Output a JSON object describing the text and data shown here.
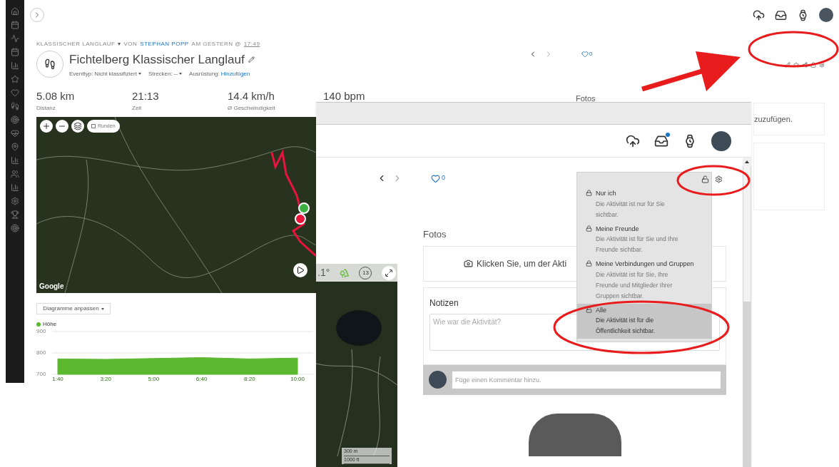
{
  "back_page": {
    "header": {
      "activity_type": "KLASSISCHER LANGLAUF",
      "by": "VON",
      "author": "STEPHAN POPP",
      "when": "AM GESTERN @",
      "time": "17:49",
      "title": "Fichtelberg Klassischer Langlauf"
    },
    "meta": [
      {
        "label": "Eventtyp:",
        "value": "Nicht klassifiziert",
        "kind": "dropdown"
      },
      {
        "label": "Strecken:",
        "value": "--",
        "kind": "dropdown"
      },
      {
        "label": "Ausrüstung:",
        "value": "Hinzufügen",
        "kind": "link"
      }
    ],
    "likes": "0",
    "stats": [
      {
        "value": "5.08 km",
        "label": "Distanz"
      },
      {
        "value": "21:13",
        "label": "Zeit"
      },
      {
        "value": "14.4 km/h",
        "label": "Ø Geschwindigkeit"
      },
      {
        "value": "140 bpm"
      }
    ],
    "map": {
      "laps_label": "Runden",
      "laps_checked": false,
      "logo": "Google"
    },
    "chart_button": "Diagramme anpassen",
    "chart": {
      "chart_data": {
        "type": "area",
        "categories": [
          "1:40",
          "3:20",
          "5:00",
          "6:40",
          "8:20",
          "10:00"
        ],
        "series": [
          {
            "name": "Höhe",
            "color": "#5cb82f",
            "values": [
              772,
              770,
              774,
              778,
              772,
              776
            ]
          }
        ],
        "ylim": [
          700,
          900
        ],
        "yticks": [
          700,
          800,
          900
        ]
      }
    },
    "photos_heading": "Fotos",
    "photo_hint": "zuzufügen."
  },
  "front_page": {
    "likes": "0",
    "privacy_menu": [
      {
        "title": "Nur ich",
        "description": "Die Aktivität ist nur für Sie sichtbar.",
        "locked": true,
        "selected": false
      },
      {
        "title": "Meine Freunde",
        "description": "Die Aktivität ist für Sie und Ihre Freunde sichtbar.",
        "locked": true,
        "selected": false
      },
      {
        "title": "Meine Verbindungen und Gruppen",
        "description": "Die Aktivität ist für Sie, Ihre Freunde und Mitglieder Ihrer Gruppen sichtbar.",
        "locked": true,
        "selected": false
      },
      {
        "title": "Alle",
        "description": "Die Aktivität ist für die Öffentlichkeit sichtbar.",
        "locked": false,
        "selected": true
      }
    ],
    "photos_heading": "Fotos",
    "upload_text": "Klicken Sie, um der Akti",
    "notes_heading": "Notizen",
    "notes_placeholder": "Wie war die Aktivität?",
    "comment_placeholder": "Füge einen Kommentar hinzu."
  },
  "mini_map": {
    "temperature": ".1°",
    "badge": "13",
    "scale": [
      "300 m",
      "1000 ft"
    ]
  }
}
